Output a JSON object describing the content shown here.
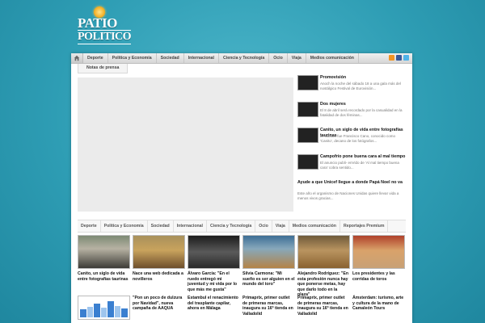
{
  "logo": {
    "line1": "PATIO",
    "line2": "POLITICO"
  },
  "topnav": {
    "items": [
      "Deporte",
      "Política y Economía",
      "Sociedad",
      "Internacional",
      "Ciencia y Tecnología",
      "Ocio",
      "Viaja",
      "Medios comunicación"
    ],
    "subitem": "Notas de prensa"
  },
  "featured": [
    {
      "title": "Promovisión",
      "desc": "Anoch la noche del sábado 18 a una gala más del nostálgico Festival de Eurovisión...",
      "thumb": "th1"
    },
    {
      "title": "Dos mujeres",
      "desc": "El 8 de abril será recordado por la casualidad en la fatalidad de dos féminas...",
      "thumb": "th2"
    },
    {
      "title": "Canito, un siglo de vida entre fotografías taurinas",
      "desc": "El sábado fue Francisco Cano, conocido como 'Canito', decano de los fotógrafos...",
      "thumb": "th3"
    },
    {
      "title": "Campofrío pone buena cara al mal tiempo",
      "desc": "El anuncio publi- enVido de 'Al mal tiempo buena cara' cobra sentido...",
      "thumb": "th4"
    },
    {
      "title": "Ayude a que Unicef llegue a donde Papá Noel no va",
      "desc": "Este año el organismo de Naciones Unidas quiere llevar vida a menos vivos gracias..."
    }
  ],
  "catnav": [
    "Deporte",
    "Política y Economía",
    "Sociedad",
    "Internacional",
    "Ciencia y Tecnología",
    "Ocio",
    "Viaja",
    "Medios comunicación",
    "Reportajes Premium"
  ],
  "grid_row1": [
    {
      "title": "Canito, un siglo de vida entre fotografías taurinas",
      "img": "p1"
    },
    {
      "title": "Nace una web dedicada a novilleros",
      "img": "p2"
    },
    {
      "title": "Álvaro García: \"En el ruedo entregó mi juventud y mi vida por lo que más me gusta\"",
      "img": "p3"
    },
    {
      "title": "Silvia Carmona: \"Mi sueño es ser alguien en el mundo del toro\"",
      "img": "p4"
    },
    {
      "title": "Alejandro Rodríguez: \"En esta profesión nunca hay que ponerse metas, hay que darlo todo en la plaza\"",
      "img": "p5"
    },
    {
      "title": "Los presidentes y las corridas de toros",
      "img": "p6"
    }
  ],
  "grid_row2": [
    {
      "title": "",
      "chart": true
    },
    {
      "title": "\"Pon un poco de dulzura por Navidad\", nueva campaña de AAQUA"
    },
    {
      "title": "Estambul el renacimiento del trasplante capilar, ahora en Málaga"
    },
    {
      "title": "Primaprix, primer outlet de primeras marcas, inaugura su 16ª tienda en Valladolid"
    },
    {
      "title": "Primaprix, primer outlet de primeras marcas, inaugura su 16ª tienda en Valladolid"
    },
    {
      "title": "Ámsterdam: turismo, arte y cultura de la mano de Camaleón Tours"
    }
  ],
  "colors": {
    "background": "#2e9db4",
    "nav_bg": "#d6d6d6",
    "accent_logo": "#f1a91b"
  }
}
